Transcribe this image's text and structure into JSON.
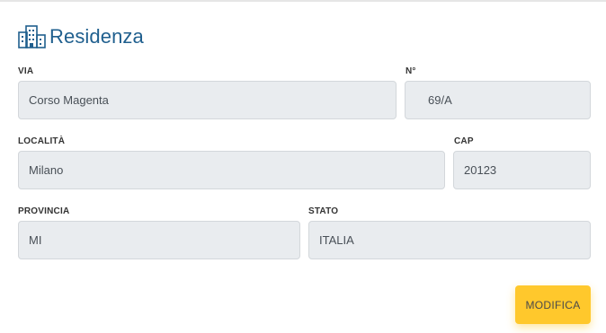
{
  "section": {
    "title": "Residenza",
    "icon": "buildings-icon",
    "accent_color": "#1f5f8e"
  },
  "fields": {
    "via": {
      "label": "VIA",
      "value": "Corso Magenta"
    },
    "numero": {
      "label": "N°",
      "value": "69/A"
    },
    "localita": {
      "label": "LOCALITÀ",
      "value": "Milano"
    },
    "cap": {
      "label": "CAP",
      "value": "20123"
    },
    "provincia": {
      "label": "PROVINCIA",
      "value": "MI"
    },
    "stato": {
      "label": "STATO",
      "value": "ITALIA"
    }
  },
  "actions": {
    "modifica_label": "MODIFICA",
    "modifica_color": "#ffc82c"
  }
}
